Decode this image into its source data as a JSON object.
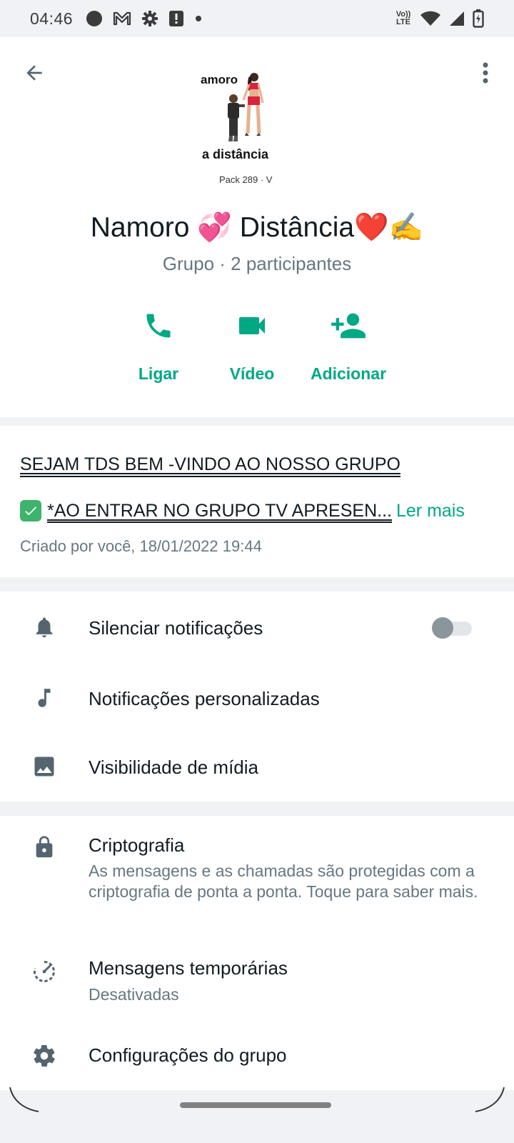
{
  "status_bar": {
    "time": "04:46",
    "left_icons": [
      "record-icon",
      "gmail-icon",
      "settings-icon",
      "alert-icon",
      "dot-icon"
    ],
    "right_icons": [
      "volte-icon",
      "wifi-icon",
      "signal-icon",
      "battery-charging-icon"
    ],
    "volte_label": "Vo)) LTE"
  },
  "header": {
    "back_icon": "arrow-left-icon",
    "menu_icon": "more-vert-icon",
    "avatar": {
      "text_top": "amoro",
      "text_bottom": "a distância",
      "text_small": "Pack 289 · V"
    },
    "group_name": "Namoro 💞 Distância❤️✍️",
    "group_subtitle": "Grupo · 2 participantes",
    "actions": [
      {
        "label": "Ligar",
        "icon": "phone-icon"
      },
      {
        "label": "Vídeo",
        "icon": "videocam-icon"
      },
      {
        "label": "Adicionar",
        "icon": "person-add-icon"
      }
    ],
    "accent_color": "#00a884"
  },
  "description": {
    "line1": "SEJAM TDS BEM -VINDO AO NOSSO GRUPO",
    "line2": "*AO ENTRAR NO GRUPO TV APRESEN...",
    "read_more": "Ler mais",
    "created": "Criado por você, 18/01/2022 19:44"
  },
  "settings": {
    "mute_label": "Silenciar notificações",
    "mute_enabled": false,
    "custom_notifications_label": "Notificações personalizadas",
    "media_visibility_label": "Visibilidade de mídia"
  },
  "privacy": {
    "encryption_title": "Criptografia",
    "encryption_sub": "As mensagens e as chamadas são protegidas com a criptografia de ponta a ponta. Toque para saber mais.",
    "disappearing_title": "Mensagens temporárias",
    "disappearing_sub": "Desativadas",
    "group_settings_title": "Configurações do grupo"
  }
}
